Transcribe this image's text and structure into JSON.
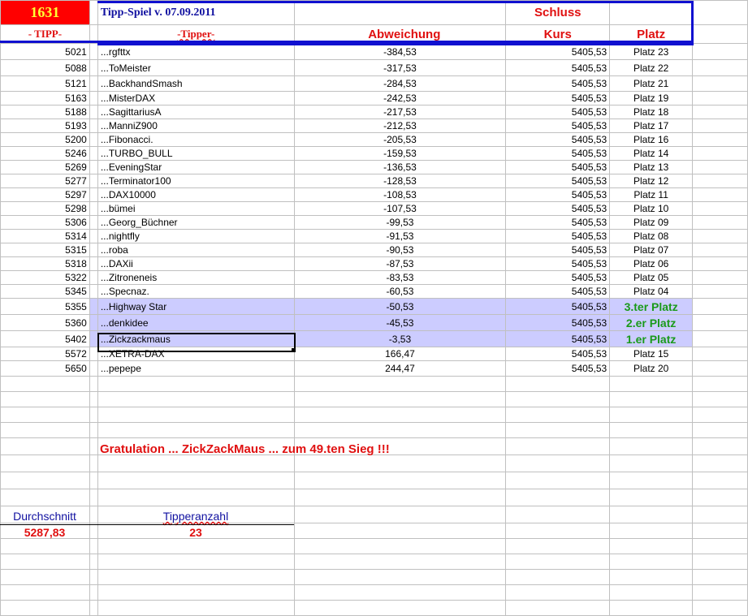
{
  "header": {
    "tipp_number": "1631",
    "title": "Tipp-Spiel v. 07.09.2011",
    "schluss": "Schluss",
    "col_tipp": "- TIPP-",
    "col_tipper": "-Tipper-",
    "col_abweichung": "Abweichung",
    "col_kurs": "Kurs",
    "col_platz": "Platz"
  },
  "rows": [
    {
      "tipp": "5021",
      "tipper": "...rgfttx",
      "abw": "-384,53",
      "kurs": "5405,53",
      "platz": "Platz 23"
    },
    {
      "tipp": "5088",
      "tipper": "...ToMeister",
      "abw": "-317,53",
      "kurs": "5405,53",
      "platz": "Platz 22"
    },
    {
      "tipp": "5121",
      "tipper": "...BackhandSmash",
      "abw": "-284,53",
      "kurs": "5405,53",
      "platz": "Platz 21"
    },
    {
      "tipp": "5163",
      "tipper": "...MisterDAX",
      "abw": "-242,53",
      "kurs": "5405,53",
      "platz": "Platz 19"
    },
    {
      "tipp": "5188",
      "tipper": "...SagittariusA",
      "abw": "-217,53",
      "kurs": "5405,53",
      "platz": "Platz 18"
    },
    {
      "tipp": "5193",
      "tipper": "...ManniZ900",
      "abw": "-212,53",
      "kurs": "5405,53",
      "platz": "Platz 17"
    },
    {
      "tipp": "5200",
      "tipper": "...Fibonacci.",
      "abw": "-205,53",
      "kurs": "5405,53",
      "platz": "Platz 16"
    },
    {
      "tipp": "5246",
      "tipper": "...TURBO_BULL",
      "abw": "-159,53",
      "kurs": "5405,53",
      "platz": "Platz 14"
    },
    {
      "tipp": "5269",
      "tipper": "...EveningStar",
      "abw": "-136,53",
      "kurs": "5405,53",
      "platz": "Platz 13"
    },
    {
      "tipp": "5277",
      "tipper": "...Terminator100",
      "abw": "-128,53",
      "kurs": "5405,53",
      "platz": "Platz 12"
    },
    {
      "tipp": "5297",
      "tipper": "...DAX10000",
      "abw": "-108,53",
      "kurs": "5405,53",
      "platz": "Platz 11"
    },
    {
      "tipp": "5298",
      "tipper": "...bümei",
      "abw": "-107,53",
      "kurs": "5405,53",
      "platz": "Platz 10"
    },
    {
      "tipp": "5306",
      "tipper": "...Georg_Büchner",
      "abw": "-99,53",
      "kurs": "5405,53",
      "platz": "Platz 09"
    },
    {
      "tipp": "5314",
      "tipper": "...nightfly",
      "abw": "-91,53",
      "kurs": "5405,53",
      "platz": "Platz 08"
    },
    {
      "tipp": "5315",
      "tipper": "...roba",
      "abw": "-90,53",
      "kurs": "5405,53",
      "platz": "Platz 07"
    },
    {
      "tipp": "5318",
      "tipper": "...DAXii",
      "abw": "-87,53",
      "kurs": "5405,53",
      "platz": "Platz 06"
    },
    {
      "tipp": "5322",
      "tipper": "...Zitroneneis",
      "abw": "-83,53",
      "kurs": "5405,53",
      "platz": "Platz 05"
    },
    {
      "tipp": "5345",
      "tipper": "...Specnaz.",
      "abw": "-60,53",
      "kurs": "5405,53",
      "platz": "Platz 04"
    },
    {
      "tipp": "5355",
      "tipper": "...Highway Star",
      "abw": "-50,53",
      "kurs": "5405,53",
      "platz": "3.ter Platz",
      "winner": true
    },
    {
      "tipp": "5360",
      "tipper": "...denkidee",
      "abw": "-45,53",
      "kurs": "5405,53",
      "platz": "2.er Platz",
      "winner": true
    },
    {
      "tipp": "5402",
      "tipper": "...Zickzackmaus",
      "abw": "-3,53",
      "kurs": "5405,53",
      "platz": "1.er Platz",
      "winner": true
    },
    {
      "tipp": "5572",
      "tipper": "...XETRA-DAX",
      "abw": "166,47",
      "kurs": "5405,53",
      "platz": "Platz 15"
    },
    {
      "tipp": "5650",
      "tipper": "...pepepe",
      "abw": "244,47",
      "kurs": "5405,53",
      "platz": "Platz 20"
    }
  ],
  "footer": {
    "gratulation": "Gratulation ...  ZickZackMaus ...  zum  49.ten Sieg !!!",
    "durchschnitt_label": "Durchschnitt",
    "durchschnitt_value": "5287,83",
    "tipperanzahl_label": "Tipperanzahl",
    "tipperanzahl_value": "23"
  },
  "colors": {
    "highlight": "#ccccff",
    "header_red": "#e01010",
    "frame_blue": "#1010d0",
    "winner_green": "#1a9a1a"
  }
}
